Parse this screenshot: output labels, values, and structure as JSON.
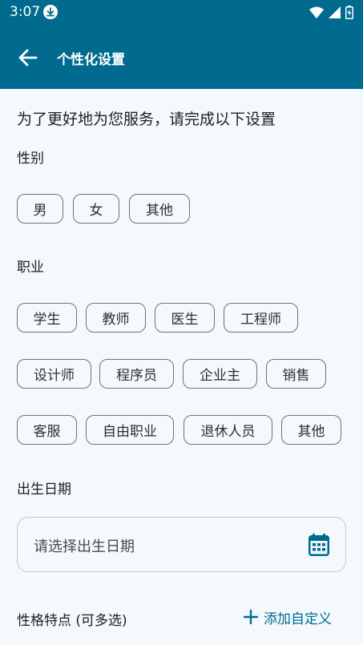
{
  "status_bar": {
    "time": "3:07"
  },
  "app_bar": {
    "title": "个性化设置"
  },
  "intro_text": "为了更好地为您服务，请完成以下设置",
  "gender": {
    "label": "性别",
    "options": [
      "男",
      "女",
      "其他"
    ]
  },
  "occupation": {
    "label": "职业",
    "options": [
      "学生",
      "教师",
      "医生",
      "工程师",
      "设计师",
      "程序员",
      "企业主",
      "销售",
      "客服",
      "自由职业",
      "退休人员",
      "其他"
    ]
  },
  "birth_date": {
    "label": "出生日期",
    "placeholder": "请选择出生日期"
  },
  "personality": {
    "label": "性格特点 (可多选)",
    "add_custom_label": "添加自定义"
  },
  "colors": {
    "primary": "#006b8f",
    "background": "#f3f9fd"
  },
  "icons": [
    "download-icon",
    "wifi-icon",
    "signal-icon",
    "battery-icon",
    "back-arrow-icon",
    "calendar-icon",
    "plus-icon"
  ]
}
